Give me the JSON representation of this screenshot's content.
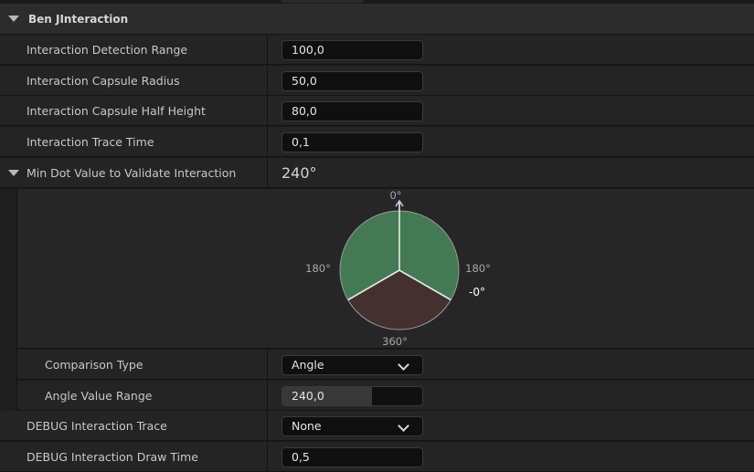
{
  "section": {
    "title": "Ben JInteraction"
  },
  "properties": {
    "detection_range": {
      "label": "Interaction Detection Range",
      "value": "100,0"
    },
    "capsule_radius": {
      "label": "Interaction Capsule Radius",
      "value": "50,0"
    },
    "capsule_half_height": {
      "label": "Interaction Capsule Half Height",
      "value": "80,0"
    },
    "trace_time": {
      "label": "Interaction Trace Time",
      "value": "0,1"
    },
    "min_dot": {
      "label": "Min Dot Value to Validate Interaction",
      "display": "240°",
      "angle_deg": 240,
      "labels": {
        "top": "0°",
        "left": "180°",
        "right": "180°",
        "right_lower": "-0°",
        "bottom": "360°"
      },
      "colors": {
        "valid": "#447a53",
        "invalid": "#43302f",
        "edge": "#9a9a9a",
        "line": "#e8e8e8",
        "text": "#a8a8a8"
      }
    },
    "comparison_type": {
      "label": "Comparison Type",
      "value": "Angle"
    },
    "angle_value_range": {
      "label": "Angle Value Range",
      "value": "240,0",
      "fill_fraction": 0.64
    },
    "debug_trace": {
      "label": "DEBUG Interaction Trace",
      "value": "None"
    },
    "debug_draw_time": {
      "label": "DEBUG Interaction Draw Time",
      "value": "0,5"
    }
  }
}
